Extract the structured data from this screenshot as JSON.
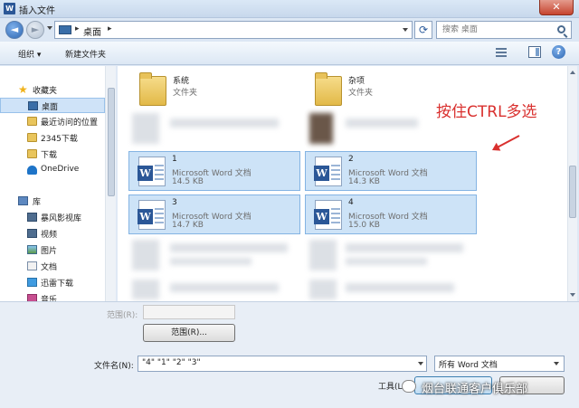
{
  "window": {
    "title": "插入文件",
    "close_label": "✕"
  },
  "address": {
    "location": "桌面"
  },
  "search": {
    "placeholder": "搜索 桌面"
  },
  "toolbar": {
    "organize_label": "组织 ▾",
    "new_folder_label": "新建文件夹"
  },
  "sidebar": {
    "items": [
      {
        "label": "收藏夹",
        "icon": "star-icon"
      },
      {
        "label": "桌面",
        "icon": "desktop-icon"
      },
      {
        "label": "最近访问的位置",
        "icon": "recent-places-icon"
      },
      {
        "label": "2345下载",
        "icon": "folder-icon"
      },
      {
        "label": "下载",
        "icon": "folder-icon"
      },
      {
        "label": "OneDrive",
        "icon": "cloud-icon"
      },
      {
        "label": "库",
        "icon": "library-icon"
      },
      {
        "label": "暴风影视库",
        "icon": "video-library-icon"
      },
      {
        "label": "视频",
        "icon": "video-icon"
      },
      {
        "label": "图片",
        "icon": "picture-icon"
      },
      {
        "label": "文档",
        "icon": "document-icon"
      },
      {
        "label": "迅雷下载",
        "icon": "download-icon"
      },
      {
        "label": "音乐",
        "icon": "music-icon"
      }
    ]
  },
  "files": [
    {
      "name": "系统",
      "type": "文件夹",
      "size": "",
      "kind": "folder"
    },
    {
      "name": "杂项",
      "type": "文件夹",
      "size": "",
      "kind": "folder"
    },
    {
      "name": "1",
      "type": "Microsoft Word 文档",
      "size": "14.5 KB",
      "kind": "word"
    },
    {
      "name": "2",
      "type": "Microsoft Word 文档",
      "size": "14.3 KB",
      "kind": "word"
    },
    {
      "name": "3",
      "type": "Microsoft Word 文档",
      "size": "14.7 KB",
      "kind": "word"
    },
    {
      "name": "4",
      "type": "Microsoft Word 文档",
      "size": "15.0 KB",
      "kind": "word"
    }
  ],
  "annotation": {
    "text": "按住CTRL多选",
    "color": "#d9302e"
  },
  "bottom": {
    "range_label": "范围(R):",
    "range_button": "范围(R)...",
    "filename_label": "文件名(N):",
    "filename_value": "\"4\" \"1\" \"2\" \"3\"",
    "filetype_value": "所有 Word 文档",
    "tools_label": "工具(L)"
  },
  "watermark": {
    "text": "烟台联通客户俱乐部"
  },
  "colors": {
    "selection": "#cde3f7",
    "selection_border": "#84b4e3",
    "word_blue": "#2b5797"
  }
}
